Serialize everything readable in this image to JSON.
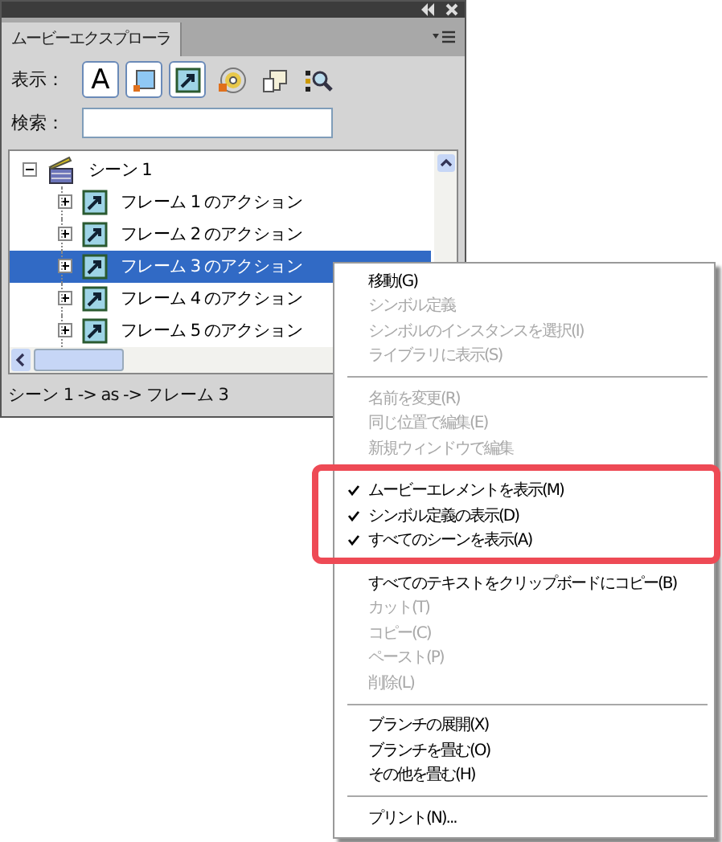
{
  "panel": {
    "title": "ムービーエクスプローラ",
    "show_label": "表示：",
    "show_buttons": [
      {
        "kind": "text",
        "glyph": "A",
        "selected": true
      },
      {
        "kind": "button",
        "selected": true
      },
      {
        "kind": "action",
        "selected": true
      },
      {
        "kind": "video",
        "selected": false
      },
      {
        "kind": "component",
        "selected": false
      },
      {
        "kind": "other",
        "selected": false
      }
    ],
    "search_label": "検索：",
    "tree": [
      {
        "label": "シーン 1",
        "kind": "scene",
        "expanded": true,
        "selected": false,
        "children": [
          {
            "label": "フレーム 1 のアクション",
            "kind": "action",
            "expanded": false,
            "selected": false
          },
          {
            "label": "フレーム 2 のアクション",
            "kind": "action",
            "expanded": false,
            "selected": false
          },
          {
            "label": "フレーム 3 のアクション",
            "kind": "action",
            "expanded": false,
            "selected": true
          },
          {
            "label": "フレーム 4 のアクション",
            "kind": "action",
            "expanded": false,
            "selected": false
          },
          {
            "label": "フレーム 5 のアクション",
            "kind": "action",
            "expanded": false,
            "selected": false
          }
        ]
      }
    ],
    "status": "シーン 1 -> as -> フレーム 3"
  },
  "context_menu": {
    "groups": [
      {
        "highlighted": false,
        "items": [
          {
            "label": "移動(G)",
            "disabled": false,
            "checked": false
          },
          {
            "label": "シンボル定義",
            "disabled": true,
            "checked": false
          },
          {
            "label": "シンボルのインスタンスを選択(I)",
            "disabled": true,
            "checked": false
          },
          {
            "label": "ライブラリに表示(S)",
            "disabled": true,
            "checked": false
          }
        ]
      },
      {
        "highlighted": false,
        "items": [
          {
            "label": "名前を変更(R)",
            "disabled": true,
            "checked": false
          },
          {
            "label": "同じ位置で編集(E)",
            "disabled": true,
            "checked": false
          },
          {
            "label": "新規ウィンドウで編集",
            "disabled": true,
            "checked": false
          }
        ]
      },
      {
        "highlighted": true,
        "items": [
          {
            "label": "ムービーエレメントを表示(M)",
            "disabled": false,
            "checked": true
          },
          {
            "label": "シンボル定義の表示(D)",
            "disabled": false,
            "checked": true
          },
          {
            "label": "すべてのシーンを表示(A)",
            "disabled": false,
            "checked": true
          }
        ]
      },
      {
        "highlighted": false,
        "items": [
          {
            "label": "すべてのテキストをクリップボードにコピー(B)",
            "disabled": false,
            "checked": false
          },
          {
            "label": "カット(T)",
            "disabled": true,
            "checked": false
          },
          {
            "label": "コピー(C)",
            "disabled": true,
            "checked": false
          },
          {
            "label": "ペースト(P)",
            "disabled": true,
            "checked": false
          },
          {
            "label": "削除(L)",
            "disabled": true,
            "checked": false
          }
        ]
      },
      {
        "highlighted": false,
        "items": [
          {
            "label": "ブランチの展開(X)",
            "disabled": false,
            "checked": false
          },
          {
            "label": "ブランチを畳む(O)",
            "disabled": false,
            "checked": false
          },
          {
            "label": "その他を畳む(H)",
            "disabled": false,
            "checked": false
          }
        ]
      },
      {
        "highlighted": false,
        "items": [
          {
            "label": "プリント(N)...",
            "disabled": false,
            "checked": false
          }
        ]
      }
    ]
  }
}
